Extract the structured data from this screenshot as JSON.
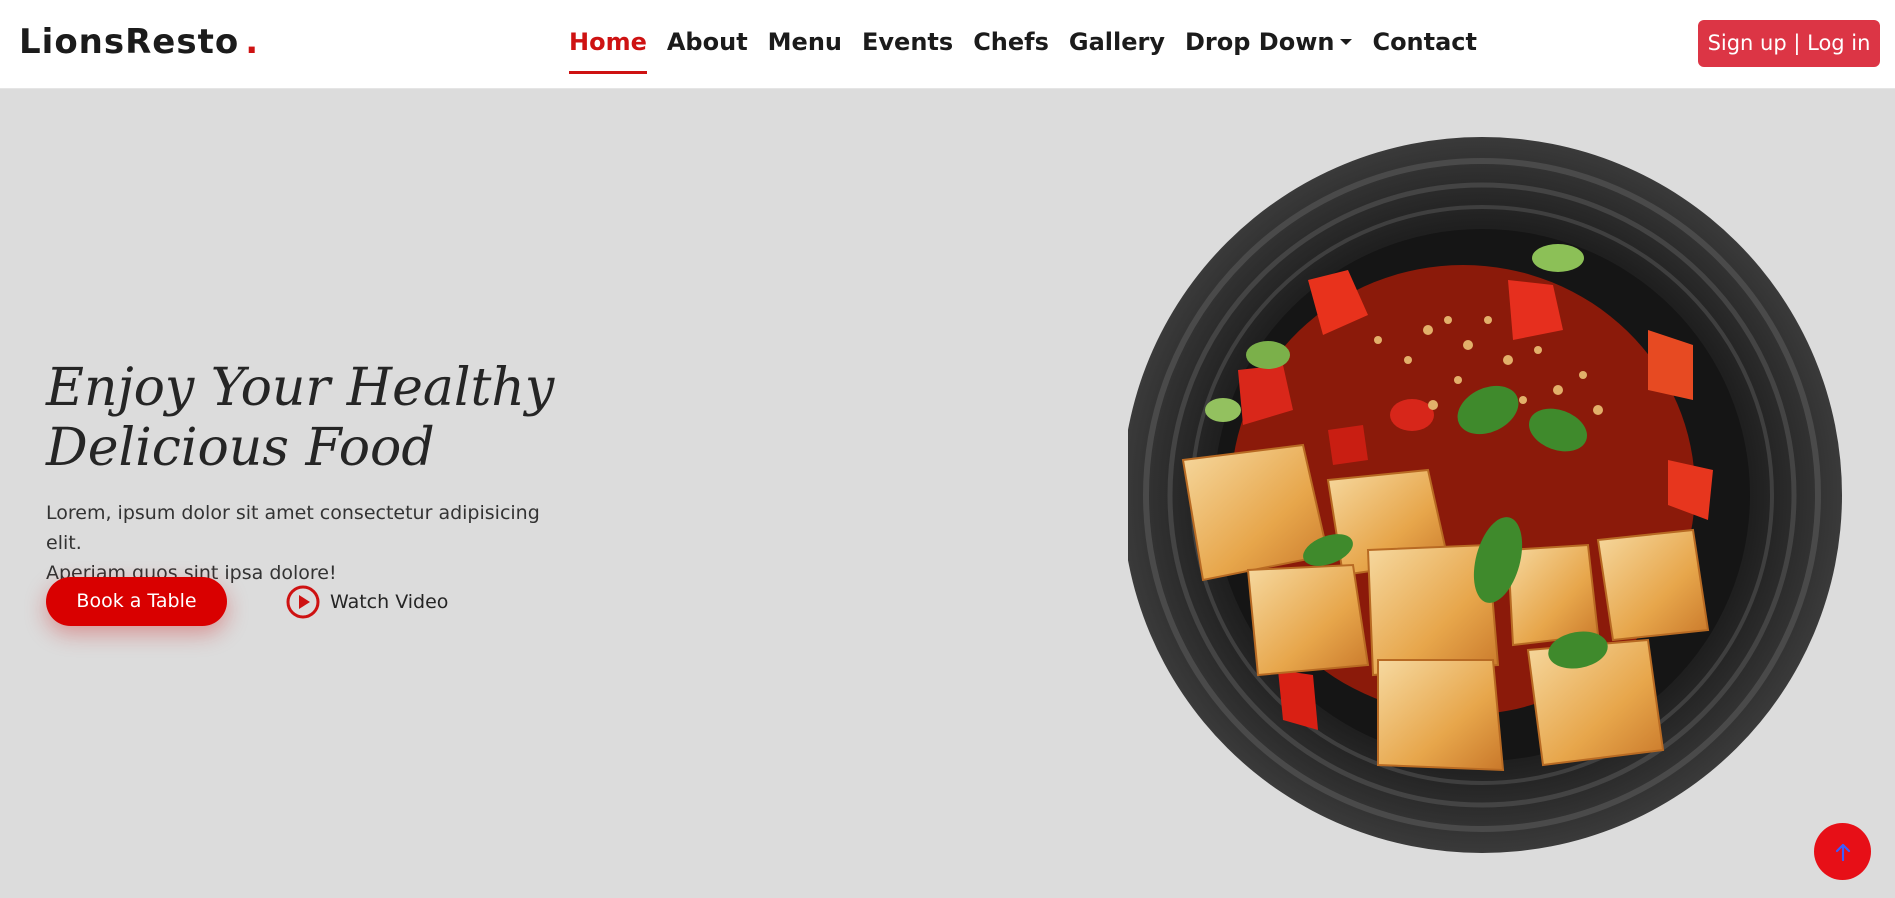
{
  "header": {
    "logo_text": "LionsResto",
    "logo_dot": ".",
    "nav": [
      {
        "label": "Home",
        "active": true
      },
      {
        "label": "About"
      },
      {
        "label": "Menu"
      },
      {
        "label": "Events"
      },
      {
        "label": "Chefs"
      },
      {
        "label": "Gallery"
      },
      {
        "label": "Drop Down"
      },
      {
        "label": "Contact"
      }
    ],
    "signup_label": "Sign up | Log in"
  },
  "hero": {
    "title_line1": "Enjoy Your Healthy",
    "title_line2": "Delicious Food",
    "desc_line1": "Lorem, ipsum dolor sit amet consectetur adipisicing elit.",
    "desc_line2": "Aperiam quos sint ipsa dolore!",
    "book_label": "Book a Table",
    "watch_label": "Watch Video"
  },
  "icons": {
    "play": "play-circle-icon",
    "back_to_top": "arrow-up-icon",
    "dropdown": "chevron-down-icon"
  },
  "colors": {
    "accent": "#ce1212",
    "signup_bg": "#dc3545",
    "book_bg": "#d90000",
    "hero_bg": "#dcdcdc",
    "back_top_bg": "#e70f17",
    "back_top_arrow": "#3b5cff"
  }
}
